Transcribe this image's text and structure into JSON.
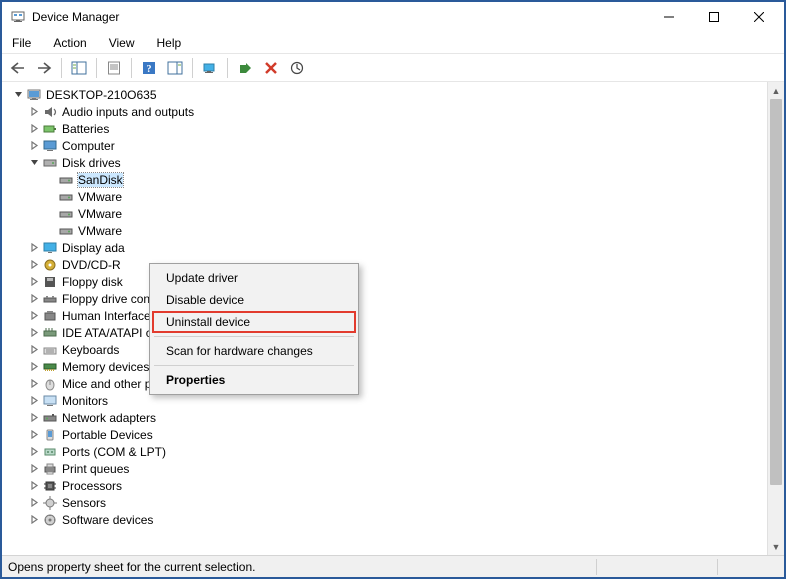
{
  "window": {
    "title": "Device Manager"
  },
  "menu": {
    "file": "File",
    "action": "Action",
    "view": "View",
    "help": "Help"
  },
  "tree": {
    "root": "DESKTOP-210O635",
    "items": [
      {
        "label": "Audio inputs and outputs",
        "expanded": false
      },
      {
        "label": "Batteries",
        "expanded": false
      },
      {
        "label": "Computer",
        "expanded": false
      },
      {
        "label": "Disk drives",
        "expanded": true,
        "children": [
          {
            "label": "SanDisk"
          },
          {
            "label": "VMware"
          },
          {
            "label": "VMware"
          },
          {
            "label": "VMware"
          }
        ]
      },
      {
        "label": "Display adapters",
        "expanded": false
      },
      {
        "label": "DVD/CD-ROM drives",
        "expanded": false
      },
      {
        "label": "Floppy disk drives",
        "expanded": false
      },
      {
        "label": "Floppy drive controllers",
        "expanded": false
      },
      {
        "label": "Human Interface Devices",
        "expanded": false
      },
      {
        "label": "IDE ATA/ATAPI controllers",
        "expanded": false
      },
      {
        "label": "Keyboards",
        "expanded": false
      },
      {
        "label": "Memory devices",
        "expanded": false
      },
      {
        "label": "Mice and other pointing devices",
        "expanded": false
      },
      {
        "label": "Monitors",
        "expanded": false
      },
      {
        "label": "Network adapters",
        "expanded": false
      },
      {
        "label": "Portable Devices",
        "expanded": false
      },
      {
        "label": "Ports (COM & LPT)",
        "expanded": false
      },
      {
        "label": "Print queues",
        "expanded": false
      },
      {
        "label": "Processors",
        "expanded": false
      },
      {
        "label": "Sensors",
        "expanded": false
      },
      {
        "label": "Software devices",
        "expanded": false
      }
    ],
    "selected_child_label": "SanDisk",
    "partial_children": {
      "c0": "SanDisk",
      "c1": "VMware",
      "c2": "VMware",
      "c3": "VMware"
    },
    "partial_labels": {
      "display": "Display ada",
      "dvd": "DVD/CD-R",
      "floppyd": "Floppy disk"
    }
  },
  "context_menu": {
    "update": "Update driver",
    "disable": "Disable device",
    "uninstall": "Uninstall device",
    "scan": "Scan for hardware changes",
    "properties": "Properties"
  },
  "status": {
    "text": "Opens property sheet for the current selection."
  }
}
